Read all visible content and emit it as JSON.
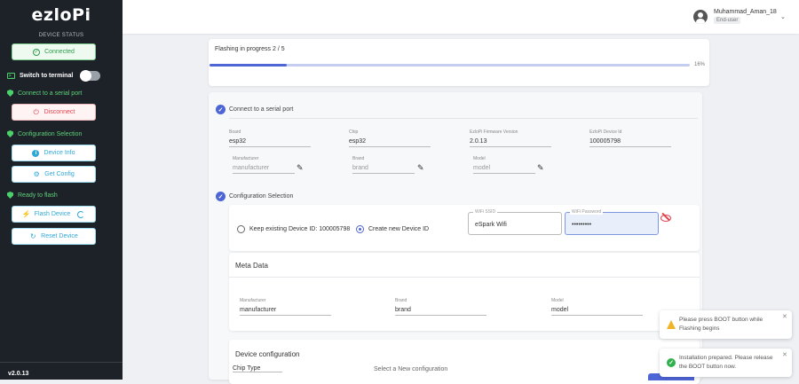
{
  "sidebar": {
    "logo": "ezloPi",
    "device_status": "DEVICE STATUS",
    "connected_label": "Connected",
    "switch_terminal_label": "Switch to terminal",
    "step_serial": "Connect to a serial port",
    "disconnect_label": "Disconnect",
    "step_config": "Configuration Selection",
    "device_info_label": "Device Info",
    "get_config_label": "Get Config",
    "step_flash": "Ready to flash",
    "flash_device_label": "Flash Device",
    "reset_device_label": "Reset Device",
    "version": "v2.0.13"
  },
  "header": {
    "user_name": "Muhammad_Aman_18",
    "user_role": "End-user"
  },
  "progress": {
    "title": "Flashing in progress 2 / 5",
    "percent_label": "16%",
    "percent": 0.16
  },
  "serial_section": {
    "title": "Connect to a serial port",
    "fields": {
      "board_label": "Board",
      "board_value": "esp32",
      "chip_label": "Chip",
      "chip_value": "esp32",
      "fw_label": "EzloPi Firmware Version",
      "fw_value": "2.0.13",
      "devid_label": "EzloPi Device Id",
      "devid_value": "100005798",
      "manufacturer_label": "Manufacturer",
      "manufacturer_value": "manufacturer",
      "brand_label": "Brand",
      "brand_value": "brand",
      "model_label": "Model",
      "model_value": "model"
    }
  },
  "config_section": {
    "title": "Configuration Selection",
    "radio_keep": "Keep existing Device ID: 100005798",
    "radio_new": "Create new Device ID",
    "wifi_ssid_label": "WiFi SSID",
    "wifi_ssid_value": "eSpark Wifi",
    "wifi_password_label": "WiFi Password",
    "wifi_password_value": "•••••••••"
  },
  "meta_data": {
    "title": "Meta Data",
    "manufacturer_label": "Manufacturer",
    "manufacturer_value": "manufacturer",
    "brand_label": "Brand",
    "brand_value": "brand",
    "model_label": "Model",
    "model_value": "model"
  },
  "device_config": {
    "title": "Device configuration",
    "chip_type_label": "Chip Type",
    "select_new_label": "Select a New configuration"
  },
  "toasts": [
    {
      "text": "Please press BOOT button while Flashing begins",
      "type": "warning"
    },
    {
      "text": "Installation prepared. Please release the BOOT button now.",
      "type": "success"
    }
  ],
  "colors": {
    "sidebar_bg": "#1d2228",
    "accent": "#4e65d6",
    "success": "#2fb14b",
    "danger": "#e0454f",
    "info": "#2fa8d8"
  }
}
